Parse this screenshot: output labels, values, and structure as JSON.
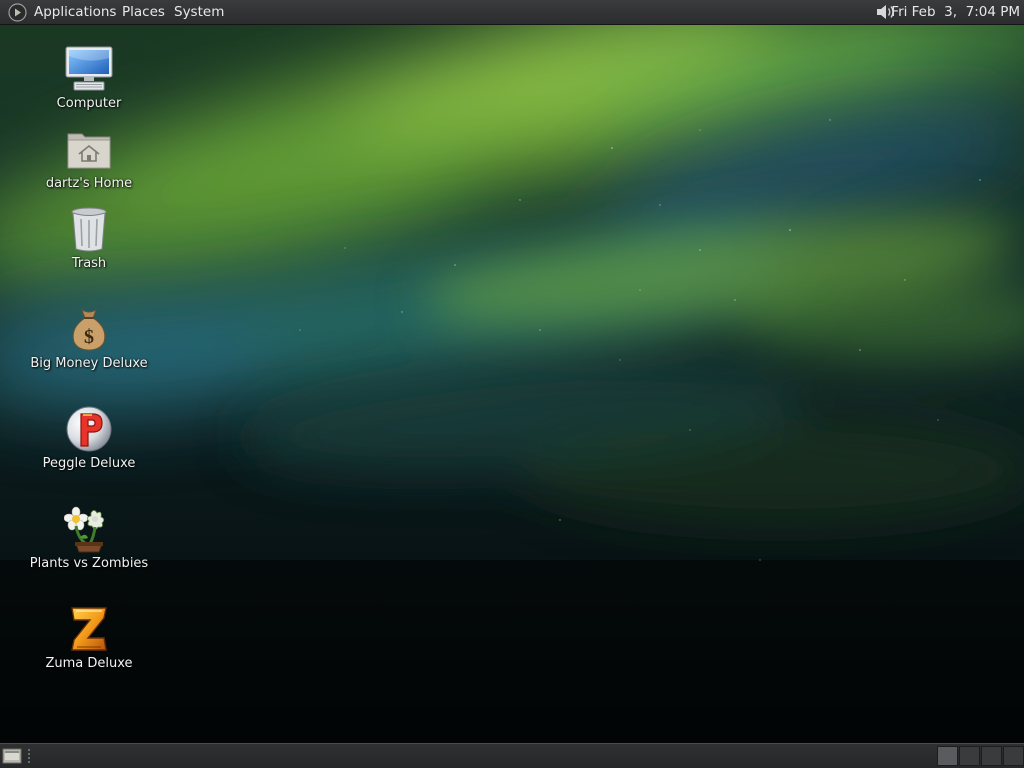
{
  "top_panel": {
    "menus": {
      "applications": "Applications",
      "places": "Places",
      "system": "System"
    },
    "clock": "Fri Feb  3,  7:04 PM"
  },
  "desktop": {
    "icons": [
      {
        "label": "Computer",
        "icon": "computer-icon"
      },
      {
        "label": "dartz's Home",
        "icon": "home-folder-icon"
      },
      {
        "label": "Trash",
        "icon": "trash-icon"
      },
      {
        "label": "Big Money Deluxe",
        "icon": "money-bag-icon"
      },
      {
        "label": "Peggle Deluxe",
        "icon": "peggle-icon"
      },
      {
        "label": "Plants vs Zombies",
        "icon": "plants-vs-zombies-icon"
      },
      {
        "label": "Zuma Deluxe",
        "icon": "zuma-icon"
      }
    ]
  },
  "bottom_panel": {
    "workspaces": 4,
    "active_workspace": 1
  },
  "colors": {
    "panel": "#2b2c2e",
    "panel_text": "#e8e8e8",
    "aurora_green": "#8cc63f",
    "aurora_teal": "#2f7f7a",
    "night_sky": "#05080a"
  }
}
